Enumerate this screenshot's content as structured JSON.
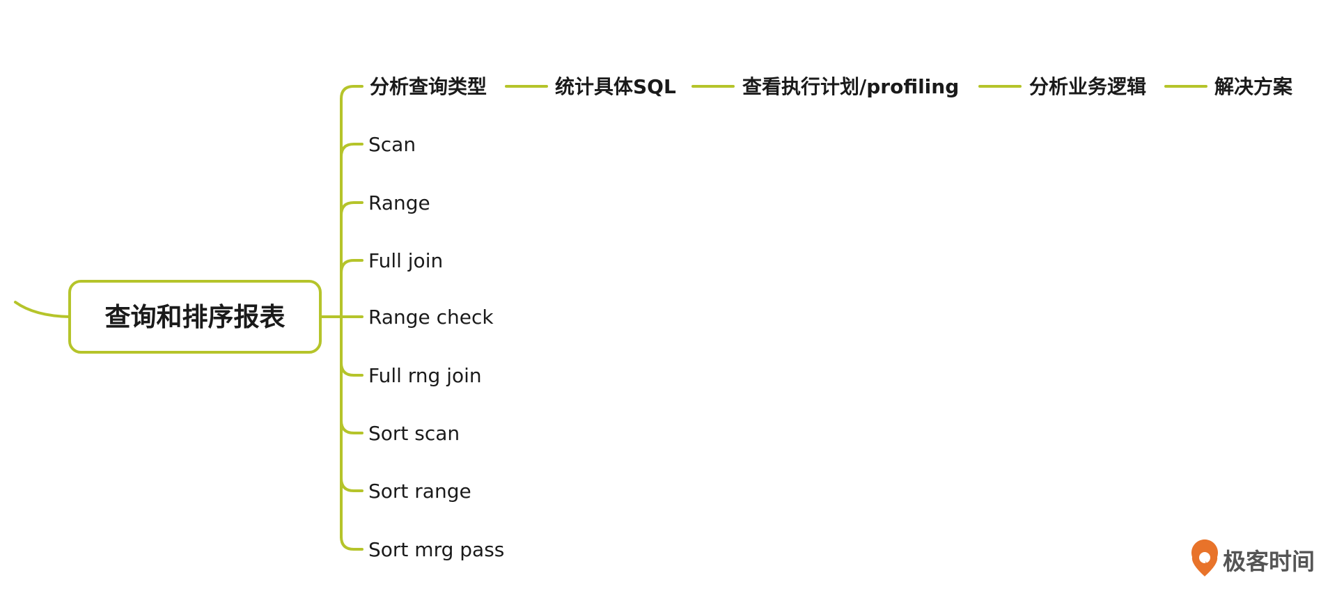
{
  "central_topic": {
    "label": "查询和排序报表"
  },
  "workflow_steps": [
    {
      "label": "分析查询类型"
    },
    {
      "label": "统计具体SQL"
    },
    {
      "label": "查看执行计划/profiling"
    },
    {
      "label": "分析业务逻辑"
    },
    {
      "label": "解决方案"
    }
  ],
  "branches": [
    {
      "label": "Scan"
    },
    {
      "label": "Range"
    },
    {
      "label": "Full join"
    },
    {
      "label": "Range check"
    },
    {
      "label": "Full rng join"
    },
    {
      "label": "Sort scan"
    },
    {
      "label": "Sort range"
    },
    {
      "label": "Sort mrg pass"
    }
  ],
  "watermark": {
    "brand": "极客时间"
  },
  "colors": {
    "connector": "#b5c42a",
    "text": "#1a1a1a",
    "brand_accent": "#e8732a",
    "brand_text": "#555555"
  }
}
